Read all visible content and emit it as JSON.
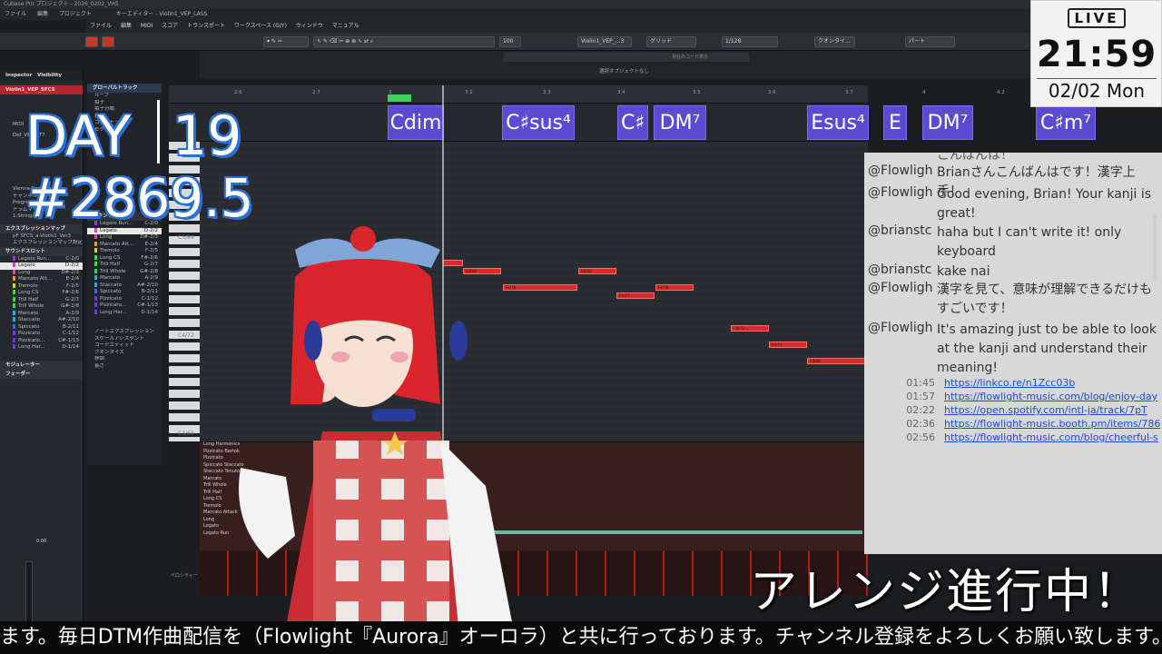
{
  "daw": {
    "title": "Cubase Pro プロジェクト - 2026_0202_VHS",
    "window_title": "キーエディター - Violin1_VEP_LASS",
    "menu": [
      "ファイル",
      "編集",
      "プロジェクト"
    ],
    "menu2": [
      "ファイル",
      "編集",
      "MIDI",
      "スコア",
      "トランスポート",
      "ワークスペース (G/Y)",
      "ウィンドウ",
      "マニュアル"
    ],
    "toolbar": {
      "quantize": "100",
      "track": "Violin1_VEP_...3",
      "grid": "グリッド",
      "grid_value": "1/128",
      "quantize_mode": "クオンタイ...",
      "part": "パート"
    },
    "status_line": "選択オブジェクトなし",
    "chord_hint": "現在のコード表示"
  },
  "inspector": {
    "tabs": [
      "Inspector",
      "Visibility"
    ],
    "track_name": "Violin1_VEP_SFCS",
    "rows": [
      "MIDI",
      "Def_VEP_KT7",
      "Vienna Ensemble Pro",
      "チャンネル 1",
      "Program 1",
      "ドラムマップなし",
      "1.Strings"
    ],
    "sections": [
      "エクスプレッションマップ",
      "サウンドスロット",
      "モジュレーター",
      "フェーダー"
    ],
    "expmap": "pF SFCS_a-Violin1_Ver3",
    "expmap_btn": "エクスプレッションマップ設定",
    "slots": [
      {
        "name": "Legato Run...",
        "key": "C-2/0",
        "color": "#8a3fd1"
      },
      {
        "name": "Legato",
        "key": "D-2/2",
        "color": "#d14ba0"
      },
      {
        "name": "Long",
        "key": "D#-2/3",
        "color": "#d14ba0"
      },
      {
        "name": "Marcato Att...",
        "key": "E-2/4",
        "color": "#d1a33f"
      },
      {
        "name": "Tremolo",
        "key": "F-2/5",
        "color": "#d1d13f"
      },
      {
        "name": "Long CS",
        "key": "F#-2/6",
        "color": "#3fd15a"
      },
      {
        "name": "Trill Half",
        "key": "G-2/7",
        "color": "#3fd15a"
      },
      {
        "name": "Trill Whole",
        "key": "G#-2/8",
        "color": "#3fd15a"
      },
      {
        "name": "Marcato",
        "key": "A-2/9",
        "color": "#3fa3d1"
      },
      {
        "name": "Staccato",
        "key": "A#-2/10",
        "color": "#3fa3d1"
      },
      {
        "name": "Spiccato",
        "key": "B-2/11",
        "color": "#3f6ad1"
      },
      {
        "name": "Pizzicato",
        "key": "C-1/12",
        "color": "#6a3fd1"
      },
      {
        "name": "Pizzicato...",
        "key": "C#-1/13",
        "color": "#6a3fd1"
      },
      {
        "name": "Long Har...",
        "key": "D-1/14",
        "color": "#6a3fd1"
      }
    ],
    "fader_value": "0.00"
  },
  "global_tracks": {
    "header": "グローバルトラック",
    "items": [
      "ループ",
      "拍子",
      "拍子分類",
      "和音",
      "コードトラック",
      "セクション"
    ],
    "lower": [
      "ノートエクスプレッション",
      "スケールアシスタント",
      "コードエディット",
      "クオンタイズ",
      "移調",
      "長さ"
    ]
  },
  "editor": {
    "ruler": [
      "2.6",
      "2.7",
      "3",
      "3.2",
      "3.3",
      "3.4",
      "3.5",
      "3.6",
      "3.7",
      "4",
      "4.2"
    ],
    "key_labels": [
      "C5/84",
      "C4/72",
      "C3/60"
    ],
    "chords": [
      {
        "label": "Cdim"
      },
      {
        "label": "C♯sus⁴"
      },
      {
        "label": "C♯"
      },
      {
        "label": "DM⁷"
      },
      {
        "label": "Esus⁴"
      },
      {
        "label": "E"
      },
      {
        "label": "DM⁷"
      },
      {
        "label": "C♯m⁷"
      }
    ],
    "notes": [
      "G4/80",
      "F4/78",
      "G4/80",
      "F4/77",
      "F4/78",
      "C4/72",
      "B3/71",
      "A3/69"
    ],
    "articulations": [
      "Long Harmonics",
      "Pizzicato Bartok",
      "Pizzicato",
      "Spiccato Staccato",
      "Staccato Tenuto",
      "Marcato",
      "Trill Whole",
      "Trill Half",
      "Long CS",
      "Tremolo",
      "Marcato Attack",
      "Long",
      "Legato",
      "Legato Run"
    ],
    "velocity_label": "ベロシティー"
  },
  "overlay": {
    "day_label": "DAY",
    "day_number": "19",
    "counter": "#2869.5",
    "arrange": "アレンジ進行中！",
    "ticker": "ます。毎日DTM作曲配信を（Flowlight『Aurora』オーロラ）と共に行っております。チャンネル登録をよろしくお願い致します。"
  },
  "clock": {
    "live": "LIVE",
    "time": "21:59",
    "date": "02/02 Mon"
  },
  "chat": {
    "top_fragment": "こんばんは！",
    "messages": [
      {
        "user": "@Flowlight",
        "text": "Brianさんこんばんはです！漢字上手！"
      },
      {
        "user": "@Flowlight",
        "text": "Good evening, Brian! Your kanji is great!"
      },
      {
        "user": "@brianstc",
        "text": "haha but I can't write it! only keyboard"
      },
      {
        "user": "@brianstc",
        "text": "kake nai"
      },
      {
        "user": "@Flowlight",
        "text": "漢字を見て、意味が理解できるだけもすごいです！"
      },
      {
        "user": "@Flowlight",
        "text": "It's amazing just to be able to look at the kanji and understand their meaning!"
      }
    ],
    "links": [
      {
        "time": "01:45",
        "url": "https://linkco.re/n1Zcc03b"
      },
      {
        "time": "01:57",
        "url": "https://flowlight-music.com/blog/enjoy-day"
      },
      {
        "time": "02:22",
        "url": "https://open.spotify.com/intl-ja/track/7pT"
      },
      {
        "time": "02:36",
        "url": "https://flowlight-music.booth.pm/items/786"
      },
      {
        "time": "02:56",
        "url": "https://flowlight-music.com/blog/cheerful-s"
      }
    ]
  }
}
